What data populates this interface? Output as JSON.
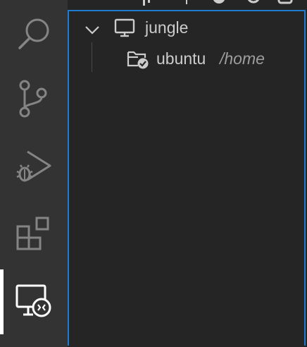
{
  "activity_bar": {
    "items": [
      {
        "icon": "search-icon",
        "active": false
      },
      {
        "icon": "source-control-icon",
        "active": false
      },
      {
        "icon": "run-and-debug-icon",
        "active": false
      },
      {
        "icon": "extensions-icon",
        "active": false
      },
      {
        "icon": "remote-explorer-icon",
        "active": true
      }
    ]
  },
  "tree": {
    "host": {
      "label": "jungle",
      "icon": "monitor-icon",
      "expanded": true
    },
    "folder": {
      "label": "ubuntu",
      "description": "/home",
      "icon": "folder-check-icon"
    }
  },
  "colors": {
    "activity_bg": "#333333",
    "sidebar_bg": "#252526",
    "focus_border": "#1f7bd0",
    "icon_fg": "#858585",
    "active_fg": "#ffffff",
    "text_fg": "#cccccc",
    "desc_fg": "#9d9d9d"
  }
}
